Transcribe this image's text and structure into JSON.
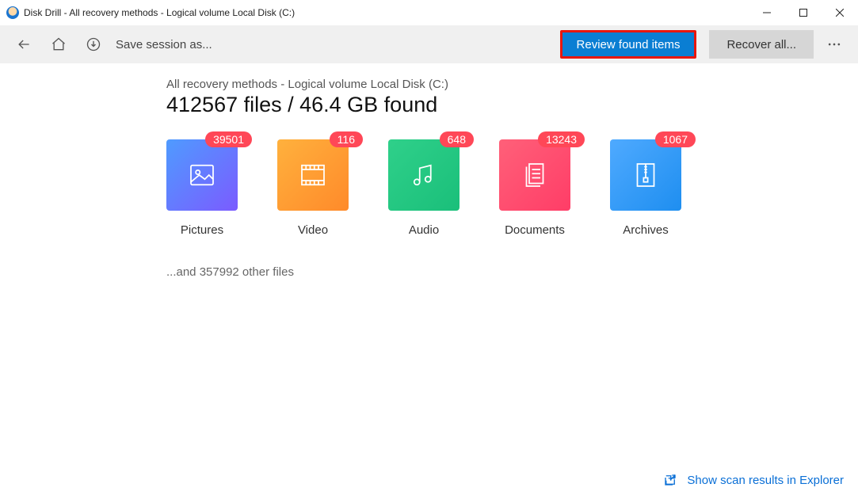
{
  "window": {
    "title": "Disk Drill - All recovery methods - Logical volume Local Disk (C:)",
    "min_icon": "minimize-icon",
    "max_icon": "maximize-icon",
    "close_icon": "close-icon"
  },
  "toolbar": {
    "back_icon": "back-arrow-icon",
    "home_icon": "home-icon",
    "download_icon": "download-icon",
    "save_session": "Save session as...",
    "review_label": "Review found items",
    "recover_label": "Recover all...",
    "more_icon": "more-icon"
  },
  "scan": {
    "subtitle": "All recovery methods - Logical volume Local Disk (C:)",
    "headline": "412567 files / 46.4 GB found",
    "other_files": "...and 357992 other files"
  },
  "categories": [
    {
      "label": "Pictures",
      "count": "39501",
      "tileClass": "tile-pictures",
      "icon": "image-icon"
    },
    {
      "label": "Video",
      "count": "116",
      "tileClass": "tile-video",
      "icon": "film-icon"
    },
    {
      "label": "Audio",
      "count": "648",
      "tileClass": "tile-audio",
      "icon": "music-icon"
    },
    {
      "label": "Documents",
      "count": "13243",
      "tileClass": "tile-docs",
      "icon": "document-icon"
    },
    {
      "label": "Archives",
      "count": "1067",
      "tileClass": "tile-arch",
      "icon": "archive-icon"
    }
  ],
  "footer": {
    "explorer_link": "Show scan results in Explorer",
    "explorer_icon": "open-external-icon"
  },
  "colors": {
    "accent_blue": "#0a7ed3",
    "highlight_border": "#e8170e",
    "badge": "#ff4757",
    "link": "#0a6fd6"
  }
}
